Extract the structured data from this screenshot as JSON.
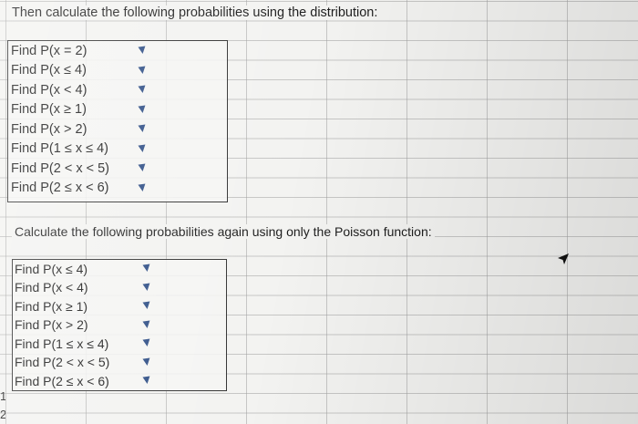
{
  "sheet": {
    "heading1": "Then calculate the following probabilities using the distribution:",
    "heading2": "Calculate the following probabilities again using only the Poisson function:"
  },
  "section1_items": [
    "Find P(x = 2)",
    "Find P(x ≤ 4)",
    "Find P(x < 4)",
    "Find P(x ≥ 1)",
    "Find P(x > 2)",
    "Find P(1 ≤ x ≤ 4)",
    "Find P(2 < x < 5)",
    "Find P(2 ≤ x < 6)"
  ],
  "section2_items": [
    "Find P(x ≤ 4)",
    "Find P(x < 4)",
    "Find P(x ≥ 1)",
    "Find P(x > 2)",
    "Find P(1 ≤ x ≤ 4)",
    "Find P(2 < x < 5)",
    "Find P(2 ≤ x < 6)"
  ],
  "row_numbers": [
    "1",
    "2"
  ],
  "icons": {
    "dropdown": "dropdown-arrow-icon",
    "cursor": "mouse-pointer-icon"
  },
  "colors": {
    "dropdown": "#2f4f86",
    "border": "#333333",
    "grid": "#a0a0a0"
  }
}
